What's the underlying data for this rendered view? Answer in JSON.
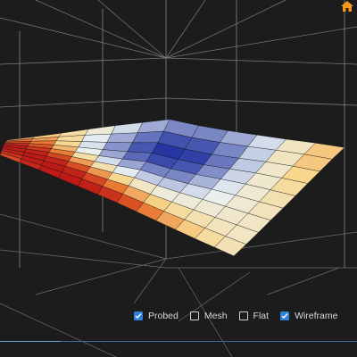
{
  "toolbar": {
    "home_icon": "home-icon",
    "home_color": "#f39a1b"
  },
  "mesh": {
    "rows": 10,
    "cols": 13,
    "deviation_map": [
      [
        0.5,
        0.35,
        0.25,
        0.2,
        0.1,
        -0.1,
        -0.3,
        -0.45,
        -0.4,
        -0.2,
        0.0,
        0.3,
        0.45
      ],
      [
        0.65,
        0.55,
        0.4,
        0.2,
        -0.1,
        -0.4,
        -0.65,
        -0.75,
        -0.6,
        -0.3,
        0.05,
        0.35,
        0.5
      ],
      [
        0.8,
        0.7,
        0.5,
        0.1,
        -0.3,
        -0.65,
        -0.9,
        -1.0,
        -0.85,
        -0.45,
        0.0,
        0.3,
        0.45
      ],
      [
        0.95,
        0.85,
        0.6,
        0.15,
        -0.3,
        -0.7,
        -0.95,
        -1.0,
        -0.8,
        -0.4,
        0.0,
        0.25,
        0.4
      ],
      [
        1.0,
        0.95,
        0.75,
        0.35,
        -0.1,
        -0.45,
        -0.7,
        -0.8,
        -0.6,
        -0.25,
        0.05,
        0.2,
        0.3
      ],
      [
        1.0,
        1.0,
        0.9,
        0.6,
        0.2,
        -0.1,
        -0.35,
        -0.45,
        -0.35,
        -0.1,
        0.05,
        0.15,
        0.25
      ],
      [
        0.95,
        1.0,
        1.0,
        0.85,
        0.55,
        0.25,
        0.05,
        -0.05,
        -0.05,
        0.05,
        0.1,
        0.15,
        0.2
      ],
      [
        0.9,
        1.0,
        1.0,
        1.0,
        0.85,
        0.6,
        0.4,
        0.25,
        0.2,
        0.15,
        0.15,
        0.15,
        0.15
      ],
      [
        0.8,
        0.95,
        1.0,
        1.0,
        1.0,
        0.9,
        0.75,
        0.6,
        0.45,
        0.35,
        0.25,
        0.2,
        0.15
      ],
      [
        0.7,
        0.85,
        1.0,
        1.0,
        1.0,
        1.0,
        1.0,
        0.85,
        0.7,
        0.55,
        0.4,
        0.3,
        0.2
      ]
    ],
    "colors": {
      "low": "#1e2f9e",
      "mid": "#eaf2f4",
      "high": "#be1a18",
      "wire": "#0d1014"
    }
  },
  "legend": {
    "probed": {
      "label": "Probed",
      "checked": true
    },
    "mesh": {
      "label": "Mesh",
      "checked": false
    },
    "flat": {
      "label": "Flat",
      "checked": false
    },
    "wireframe": {
      "label": "Wireframe",
      "checked": true
    }
  },
  "progress": {
    "value": 0.17,
    "color": "#6aa6de"
  }
}
